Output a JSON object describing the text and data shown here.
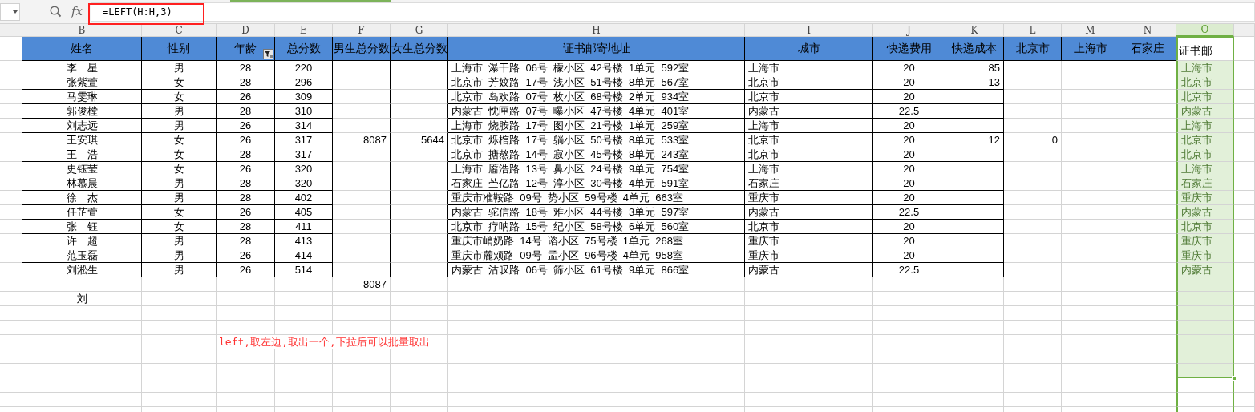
{
  "formula_bar": {
    "fx_label": "fx",
    "formula": "=LEFT(H:H,3)"
  },
  "columns": [
    {
      "letter": "B",
      "header": "姓名",
      "filtered": false,
      "header_fill": true,
      "selected": false
    },
    {
      "letter": "C",
      "header": "性别",
      "filtered": false,
      "header_fill": true,
      "selected": false
    },
    {
      "letter": "D",
      "header": "年龄",
      "filtered": true,
      "header_fill": true,
      "selected": false
    },
    {
      "letter": "E",
      "header": "总分数",
      "filtered": false,
      "header_fill": true,
      "selected": false
    },
    {
      "letter": "F",
      "header": "男生总分数",
      "filtered": false,
      "header_fill": true,
      "selected": false
    },
    {
      "letter": "G",
      "header": "女生总分数",
      "filtered": false,
      "header_fill": true,
      "selected": false
    },
    {
      "letter": "H",
      "header": "证书邮寄地址",
      "filtered": false,
      "header_fill": true,
      "selected": false
    },
    {
      "letter": "I",
      "header": "城市",
      "filtered": false,
      "header_fill": true,
      "selected": false
    },
    {
      "letter": "J",
      "header": "快递费用",
      "filtered": false,
      "header_fill": true,
      "selected": false
    },
    {
      "letter": "K",
      "header": "快递成本",
      "filtered": false,
      "header_fill": true,
      "selected": false
    },
    {
      "letter": "L",
      "header": "北京市",
      "filtered": false,
      "header_fill": true,
      "selected": false
    },
    {
      "letter": "M",
      "header": "上海市",
      "filtered": false,
      "header_fill": true,
      "selected": false
    },
    {
      "letter": "N",
      "header": "石家庄",
      "filtered": false,
      "header_fill": true,
      "selected": false
    },
    {
      "letter": "O",
      "header": "证书邮",
      "filtered": false,
      "header_fill": false,
      "selected": true
    }
  ],
  "rows": [
    {
      "B": "李　星",
      "C": "男",
      "D": "28",
      "E": "220",
      "H": "上海市  瀑干路  06号  檬小区  42号楼  1单元  592室",
      "I": "上海市",
      "J": "20",
      "K": "85",
      "O": "上海市"
    },
    {
      "B": "张紫萱",
      "C": "女",
      "D": "28",
      "E": "296",
      "H": "北京市  芳姣路  17号  浅小区  51号楼  8单元  567室",
      "I": "北京市",
      "J": "20",
      "K": "13",
      "O": "北京市"
    },
    {
      "B": "马雯琳",
      "C": "女",
      "D": "26",
      "E": "309",
      "H": "北京市  岛欢路  07号  枚小区  68号楼  2单元  934室",
      "I": "北京市",
      "J": "20",
      "O": "北京市"
    },
    {
      "B": "郭俊樘",
      "C": "男",
      "D": "28",
      "E": "310",
      "H": "内蒙古  忱匣路  07号  曝小区  47号楼  4单元  401室",
      "I": "内蒙古",
      "J": "22.5",
      "O": "内蒙古"
    },
    {
      "B": "刘志远",
      "C": "男",
      "D": "26",
      "E": "314",
      "H": "上海市  烧胺路  17号  图小区  21号楼  1单元  259室",
      "I": "上海市",
      "J": "20",
      "O": "上海市"
    },
    {
      "B": "王安琪",
      "C": "女",
      "D": "26",
      "E": "317",
      "F": "8087",
      "G": "5644",
      "H": "北京市  烁棺路  17号  躺小区  50号楼  8单元  533室",
      "I": "北京市",
      "J": "20",
      "K": "12",
      "L": "0",
      "O": "北京市"
    },
    {
      "B": "王　浩",
      "C": "女",
      "D": "28",
      "E": "317",
      "H": "北京市  搪熬路  14号  寂小区  45号楼  8单元  243室",
      "I": "北京市",
      "J": "20",
      "O": "北京市"
    },
    {
      "B": "史钰莹",
      "C": "女",
      "D": "26",
      "E": "320",
      "H": "上海市  靥浩路  13号  鼻小区  24号楼  9单元  754室",
      "I": "上海市",
      "J": "20",
      "O": "上海市"
    },
    {
      "B": "林慕晨",
      "C": "男",
      "D": "28",
      "E": "320",
      "H": "石家庄  苎亿路  12号  淳小区  30号楼  4单元  591室",
      "I": "石家庄",
      "J": "20",
      "O": "石家庄"
    },
    {
      "B": "徐　杰",
      "C": "男",
      "D": "28",
      "E": "402",
      "H": "重庆市准鞍路  09号  势小区  59号楼  4单元  663室",
      "I": "重庆市",
      "J": "20",
      "O": "重庆市"
    },
    {
      "B": "任芷萱",
      "C": "女",
      "D": "26",
      "E": "405",
      "H": "内蒙古  驼信路  18号  难小区  44号楼  3单元  597室",
      "I": "内蒙古",
      "J": "22.5",
      "O": "内蒙古"
    },
    {
      "B": "张　钰",
      "C": "女",
      "D": "28",
      "E": "411",
      "H": "北京市  疗呐路  15号  纪小区  58号楼  6单元  560室",
      "I": "北京市",
      "J": "20",
      "O": "北京市"
    },
    {
      "B": "许　超",
      "C": "男",
      "D": "28",
      "E": "413",
      "H": "重庆市峭奶路  14号  谘小区  75号楼  1单元  268室",
      "I": "重庆市",
      "J": "20",
      "O": "重庆市"
    },
    {
      "B": "范玉磊",
      "C": "男",
      "D": "26",
      "E": "414",
      "H": "重庆市麓颊路  09号  孟小区  96号楼  4单元  958室",
      "I": "重庆市",
      "J": "20",
      "O": "重庆市"
    },
    {
      "B": "刘淞生",
      "C": "男",
      "D": "26",
      "E": "514",
      "H": "内蒙古  沽叹路  06号  筛小区  61号楼  9单元  866室",
      "I": "内蒙古",
      "J": "22.5",
      "O": "内蒙古"
    }
  ],
  "extra_rows": [
    {
      "F": "8087"
    },
    {
      "B": "刘"
    }
  ],
  "note": {
    "text": "left,取左边,取出一个,下拉后可以批量取出"
  }
}
